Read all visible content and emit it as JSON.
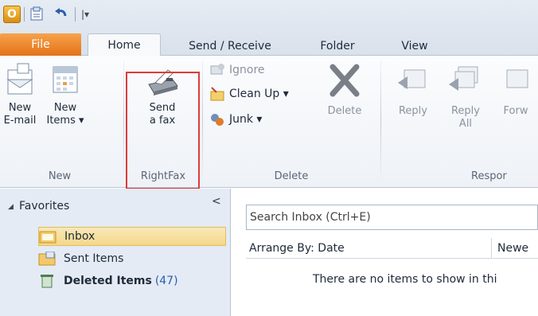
{
  "qat": {
    "logo": "O",
    "more": "|▾"
  },
  "tabs": {
    "file": "File",
    "home": "Home",
    "send_receive": "Send / Receive",
    "folder": "Folder",
    "view": "View"
  },
  "ribbon": {
    "new_group": {
      "label": "New",
      "new_email": "New\nE-mail",
      "new_items": "New\nItems ▾"
    },
    "rightfax_group": {
      "label": "RightFax",
      "send_fax": "Send\na fax"
    },
    "delete_group": {
      "label": "Delete",
      "ignore": "Ignore",
      "clean_up": "Clean Up ▾",
      "junk": "Junk ▾",
      "delete": "Delete"
    },
    "respond_group": {
      "label": "Respor",
      "reply": "Reply",
      "reply_all": "Reply\nAll",
      "forward": "Forw"
    }
  },
  "nav": {
    "favorites": "Favorites",
    "collapse": "<",
    "folders": [
      {
        "name": "Inbox"
      },
      {
        "name": "Sent Items"
      },
      {
        "name": "Deleted Items",
        "count": "(47)"
      }
    ]
  },
  "mail": {
    "search_placeholder": "Search Inbox (Ctrl+E)",
    "arrange_by": "Arrange By: Date",
    "newest": "Newe",
    "empty_message": "There are no items to show in thi"
  },
  "colors": {
    "file_tab": "#e3731a",
    "highlight": "#e03a3a",
    "selected_folder": "#f4d78a",
    "count": "#2a5db0"
  }
}
